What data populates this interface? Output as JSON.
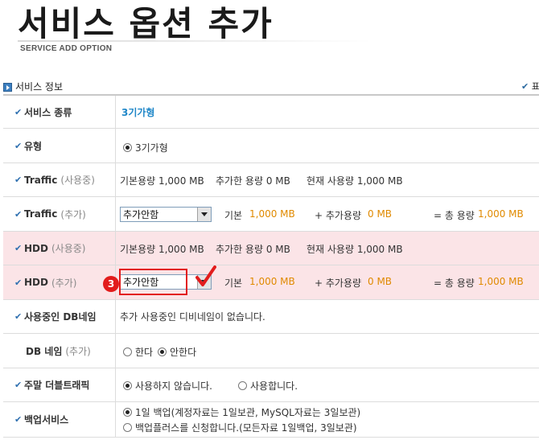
{
  "header": {
    "title": "서비스 옵션 추가",
    "subtitle": "SERVICE ADD OPTION"
  },
  "section": {
    "title": "서비스 정보",
    "right_text": "표"
  },
  "rows": {
    "service_type": {
      "label": "서비스 종류",
      "value": "3기가형"
    },
    "type": {
      "label": "유형",
      "option": "3기가형"
    },
    "traffic_used": {
      "label": "Traffic",
      "suffix": "(사용중)",
      "base": "기본용량 1,000 MB",
      "added": "추가한 용량 0 MB",
      "current": "현재 사용량 1,000 MB"
    },
    "traffic_add": {
      "label": "Traffic",
      "suffix": "(추가)",
      "select": "추가안함",
      "base_label": "기본",
      "base_value": "1,000 MB",
      "add_label": "+ 추가용량",
      "add_value": "0 MB",
      "total_label": "= 총 용량",
      "total_value": "1,000 MB"
    },
    "hdd_used": {
      "label": "HDD",
      "suffix": "(사용중)",
      "base": "기본용량 1,000 MB",
      "added": "추가한 용량 0 MB",
      "current": "현재 사용량 1,000 MB"
    },
    "hdd_add": {
      "label": "HDD",
      "suffix": "(추가)",
      "step_badge": "3",
      "select": "추가안함",
      "base_label": "기본",
      "base_value": "1,000 MB",
      "add_label": "+ 추가용량",
      "add_value": "0 MB",
      "total_label": "= 총 용량",
      "total_value": "1,000 MB"
    },
    "db_name_used": {
      "label": "사용중인 DB네임",
      "value": "추가 사용중인 디비네임이 없습니다."
    },
    "db_name_add": {
      "label": "DB 네임",
      "suffix": "(추가)",
      "opt_yes": "한다",
      "opt_no": "안한다"
    },
    "weekend_traffic": {
      "label": "주말 더블트래픽",
      "opt_no": "사용하지 않습니다.",
      "opt_yes": "사용합니다."
    },
    "backup": {
      "label": "백업서비스",
      "opt1": "1일 백업(계정자료는 1일보관, MySQL자료는 3일보관)",
      "opt2": "백업플러스를 신청합니다.(모든자료 1일백업, 3일보관)"
    }
  },
  "colors": {
    "accent_blue": "#1f87c8",
    "value_orange": "#e08a00",
    "highlight_pink": "#fbe4e7",
    "annotation_red": "#e21c1c"
  }
}
